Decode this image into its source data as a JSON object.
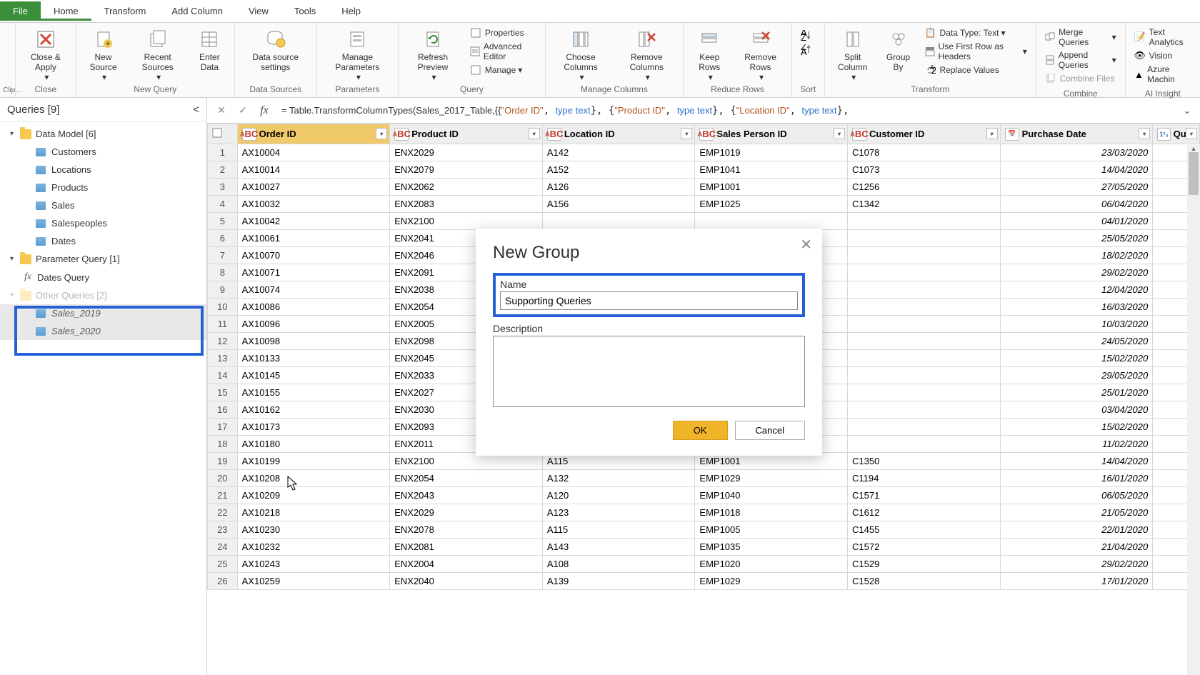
{
  "tabs": {
    "file": "File",
    "home": "Home",
    "transform": "Transform",
    "addcol": "Add Column",
    "view": "View",
    "tools": "Tools",
    "help": "Help"
  },
  "ribbon": {
    "close": {
      "closeapply": "Close &\nApply",
      "label": "Close"
    },
    "newquery": {
      "newsource": "New\nSource",
      "recent": "Recent\nSources",
      "enter": "Enter\nData",
      "label": "New Query"
    },
    "datasources": {
      "dss": "Data source\nsettings",
      "label": "Data Sources"
    },
    "parameters": {
      "mp": "Manage\nParameters",
      "label": "Parameters"
    },
    "query": {
      "refresh": "Refresh\nPreview",
      "props": "Properties",
      "adv": "Advanced Editor",
      "manage": "Manage",
      "label": "Query"
    },
    "mcols": {
      "choose": "Choose\nColumns",
      "remove": "Remove\nColumns",
      "label": "Manage Columns"
    },
    "rrows": {
      "keep": "Keep\nRows",
      "remove": "Remove\nRows",
      "label": "Reduce Rows"
    },
    "sort": {
      "label": "Sort"
    },
    "transform": {
      "split": "Split\nColumn",
      "group": "Group\nBy",
      "dt": "Data Type: Text",
      "first": "Use First Row as Headers",
      "replace": "Replace Values",
      "label": "Transform"
    },
    "combine": {
      "merge": "Merge Queries",
      "append": "Append Queries",
      "files": "Combine Files",
      "label": "Combine"
    },
    "ai": {
      "text": "Text Analytics",
      "vision": "Vision",
      "azure": "Azure Machin",
      "label": "AI Insight"
    }
  },
  "queries": {
    "title": "Queries [9]",
    "g1": "Data Model [6]",
    "items1": [
      "Customers",
      "Locations",
      "Products",
      "Sales",
      "Salespeoples",
      "Dates"
    ],
    "g2": "Parameter Query [1]",
    "dq": "Dates Query",
    "g3": "Other Queries [2]",
    "s1": "Sales_2019",
    "s2": "Sales_2020"
  },
  "formula": {
    "pre": "= Table.TransformColumnTypes(Sales_2017_Table,{{",
    "s1": "\"Order ID\"",
    "t1": "type text",
    "s2": "\"Product ID\"",
    "t2": "type text",
    "s3": "\"Location ID\"",
    "t3": "type text"
  },
  "columns": [
    "Order ID",
    "Product ID",
    "Location ID",
    "Sales Person ID",
    "Customer ID",
    "Purchase Date",
    "Quar"
  ],
  "rows": [
    [
      "AX10004",
      "ENX2029",
      "A142",
      "EMP1019",
      "C1078",
      "23/03/2020"
    ],
    [
      "AX10014",
      "ENX2079",
      "A152",
      "EMP1041",
      "C1073",
      "14/04/2020"
    ],
    [
      "AX10027",
      "ENX2062",
      "A126",
      "EMP1001",
      "C1256",
      "27/05/2020"
    ],
    [
      "AX10032",
      "ENX2083",
      "A156",
      "EMP1025",
      "C1342",
      "06/04/2020"
    ],
    [
      "AX10042",
      "ENX2100",
      "",
      "",
      "",
      "04/01/2020"
    ],
    [
      "AX10061",
      "ENX2041",
      "",
      "",
      "",
      "25/05/2020"
    ],
    [
      "AX10070",
      "ENX2046",
      "",
      "",
      "",
      "18/02/2020"
    ],
    [
      "AX10071",
      "ENX2091",
      "",
      "",
      "",
      "29/02/2020"
    ],
    [
      "AX10074",
      "ENX2038",
      "",
      "",
      "",
      "12/04/2020"
    ],
    [
      "AX10086",
      "ENX2054",
      "",
      "",
      "",
      "16/03/2020"
    ],
    [
      "AX10096",
      "ENX2005",
      "",
      "",
      "",
      "10/03/2020"
    ],
    [
      "AX10098",
      "ENX2098",
      "",
      "",
      "",
      "24/05/2020"
    ],
    [
      "AX10133",
      "ENX2045",
      "",
      "",
      "",
      "15/02/2020"
    ],
    [
      "AX10145",
      "ENX2033",
      "",
      "",
      "",
      "29/05/2020"
    ],
    [
      "AX10155",
      "ENX2027",
      "",
      "",
      "",
      "25/01/2020"
    ],
    [
      "AX10162",
      "ENX2030",
      "",
      "",
      "",
      "03/04/2020"
    ],
    [
      "AX10173",
      "ENX2093",
      "",
      "",
      "",
      "15/02/2020"
    ],
    [
      "AX10180",
      "ENX2011",
      "",
      "",
      "",
      "11/02/2020"
    ],
    [
      "AX10199",
      "ENX2100",
      "A115",
      "EMP1001",
      "C1350",
      "14/04/2020"
    ],
    [
      "AX10208",
      "ENX2054",
      "A132",
      "EMP1029",
      "C1194",
      "16/01/2020"
    ],
    [
      "AX10209",
      "ENX2043",
      "A120",
      "EMP1040",
      "C1571",
      "06/05/2020"
    ],
    [
      "AX10218",
      "ENX2029",
      "A123",
      "EMP1018",
      "C1612",
      "21/05/2020"
    ],
    [
      "AX10230",
      "ENX2078",
      "A115",
      "EMP1005",
      "C1455",
      "22/01/2020"
    ],
    [
      "AX10232",
      "ENX2081",
      "A143",
      "EMP1035",
      "C1572",
      "21/04/2020"
    ],
    [
      "AX10243",
      "ENX2004",
      "A108",
      "EMP1020",
      "C1529",
      "29/02/2020"
    ],
    [
      "AX10259",
      "ENX2040",
      "A139",
      "EMP1029",
      "C1528",
      "17/01/2020"
    ]
  ],
  "dialog": {
    "title": "New Group",
    "name_label": "Name",
    "name_value": "Supporting Queries",
    "desc_label": "Description",
    "ok": "OK",
    "cancel": "Cancel"
  }
}
